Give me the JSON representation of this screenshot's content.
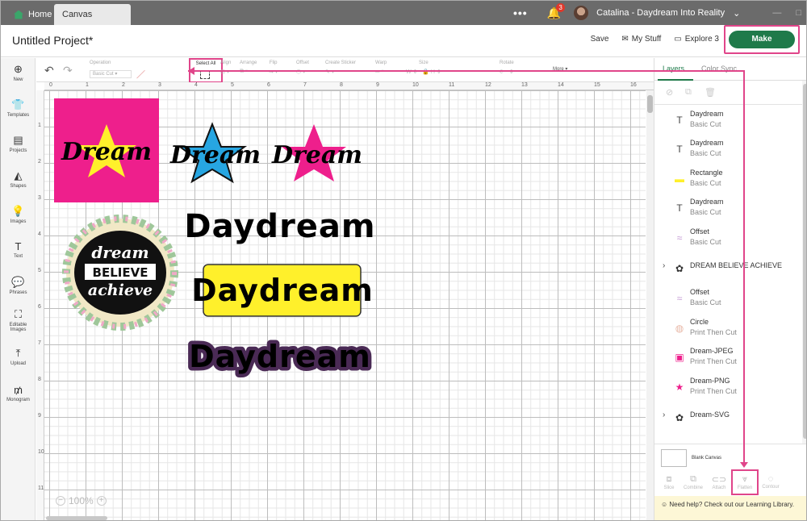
{
  "tabs": {
    "home": "Home",
    "canvas": "Canvas"
  },
  "topbar": {
    "more": "•••",
    "notifications": "3",
    "user": "Catalina - Daydream Into Reality"
  },
  "header": {
    "title": "Untitled Project*",
    "save": "Save",
    "my_stuff": "My Stuff",
    "explore": "Explore 3",
    "make": "Make"
  },
  "sidebar": [
    {
      "label": "New",
      "icon": "plus-icon"
    },
    {
      "label": "Templates",
      "icon": "shirt-icon"
    },
    {
      "label": "Projects",
      "icon": "projects-icon"
    },
    {
      "label": "Shapes",
      "icon": "shapes-icon"
    },
    {
      "label": "Images",
      "icon": "bulb-icon"
    },
    {
      "label": "Text",
      "icon": "text-icon"
    },
    {
      "label": "Phrases",
      "icon": "speech-icon"
    },
    {
      "label": "Editable Images",
      "icon": "editable-icon"
    },
    {
      "label": "Upload",
      "icon": "upload-icon"
    },
    {
      "label": "Monogram",
      "icon": "monogram-icon"
    }
  ],
  "toolbar": {
    "operation": "Operation",
    "operation_value": "Basic Cut",
    "select_all": "Select All",
    "align": "Align",
    "arrange": "Arrange",
    "flip": "Flip",
    "offset": "Offset",
    "create_sticker": "Create Sticker",
    "warp": "Warp",
    "size": "Size",
    "rotate": "Rotate",
    "more": "More ▾"
  },
  "ruler": {
    "h": [
      "0",
      "1",
      "2",
      "3",
      "4",
      "5",
      "6",
      "7",
      "8",
      "9",
      "10",
      "11",
      "12",
      "13",
      "14",
      "15",
      "16"
    ],
    "v": [
      "1",
      "2",
      "3",
      "4",
      "5",
      "6",
      "7",
      "8",
      "9",
      "10",
      "11"
    ]
  },
  "canvas": {
    "dream1": "Dream",
    "dream2": "Dream",
    "dream3": "Dream",
    "daydream1": "Daydream",
    "daydream2": "Daydream",
    "daydream3": "Daydream",
    "badge1": "dream",
    "badge2": "BELIEVE",
    "badge3": "achieve",
    "zoom": "100%",
    "colors": {
      "pink": "#ee1f8c",
      "yellow": "#fff02b",
      "blue": "#27a6e2",
      "lavender": "#c59ad4"
    }
  },
  "panel": {
    "tab_layers": "Layers",
    "tab_color_sync": "Color Sync",
    "layers": [
      {
        "name": "Daydream",
        "type": "Basic Cut",
        "icon": "text-icon"
      },
      {
        "name": "Daydream",
        "type": "Basic Cut",
        "icon": "text-icon"
      },
      {
        "name": "Rectangle",
        "type": "Basic Cut",
        "icon": "rectangle-icon"
      },
      {
        "name": "Daydream",
        "type": "Basic Cut",
        "icon": "text-icon"
      },
      {
        "name": "Offset",
        "type": "Basic Cut",
        "icon": "offset-icon"
      },
      {
        "name": "DREAM BELIEVE ACHIEVE",
        "type": "",
        "icon": "group-icon",
        "group": true
      },
      {
        "name": "Offset",
        "type": "Basic Cut",
        "icon": "offset-icon"
      },
      {
        "name": "Circle",
        "type": "Print Then Cut",
        "icon": "circle-icon"
      },
      {
        "name": "Dream-JPEG",
        "type": "Print Then Cut",
        "icon": "image-icon"
      },
      {
        "name": "Dream-PNG",
        "type": "Print Then Cut",
        "icon": "star-icon"
      },
      {
        "name": "Dream-SVG",
        "type": "",
        "icon": "group-icon",
        "group": true
      }
    ],
    "blank_canvas": "Blank Canvas",
    "tools": [
      "Slice",
      "Combine",
      "Attach",
      "Flatten",
      "Contour"
    ],
    "help": "Need help? Check out our Learning Library."
  }
}
